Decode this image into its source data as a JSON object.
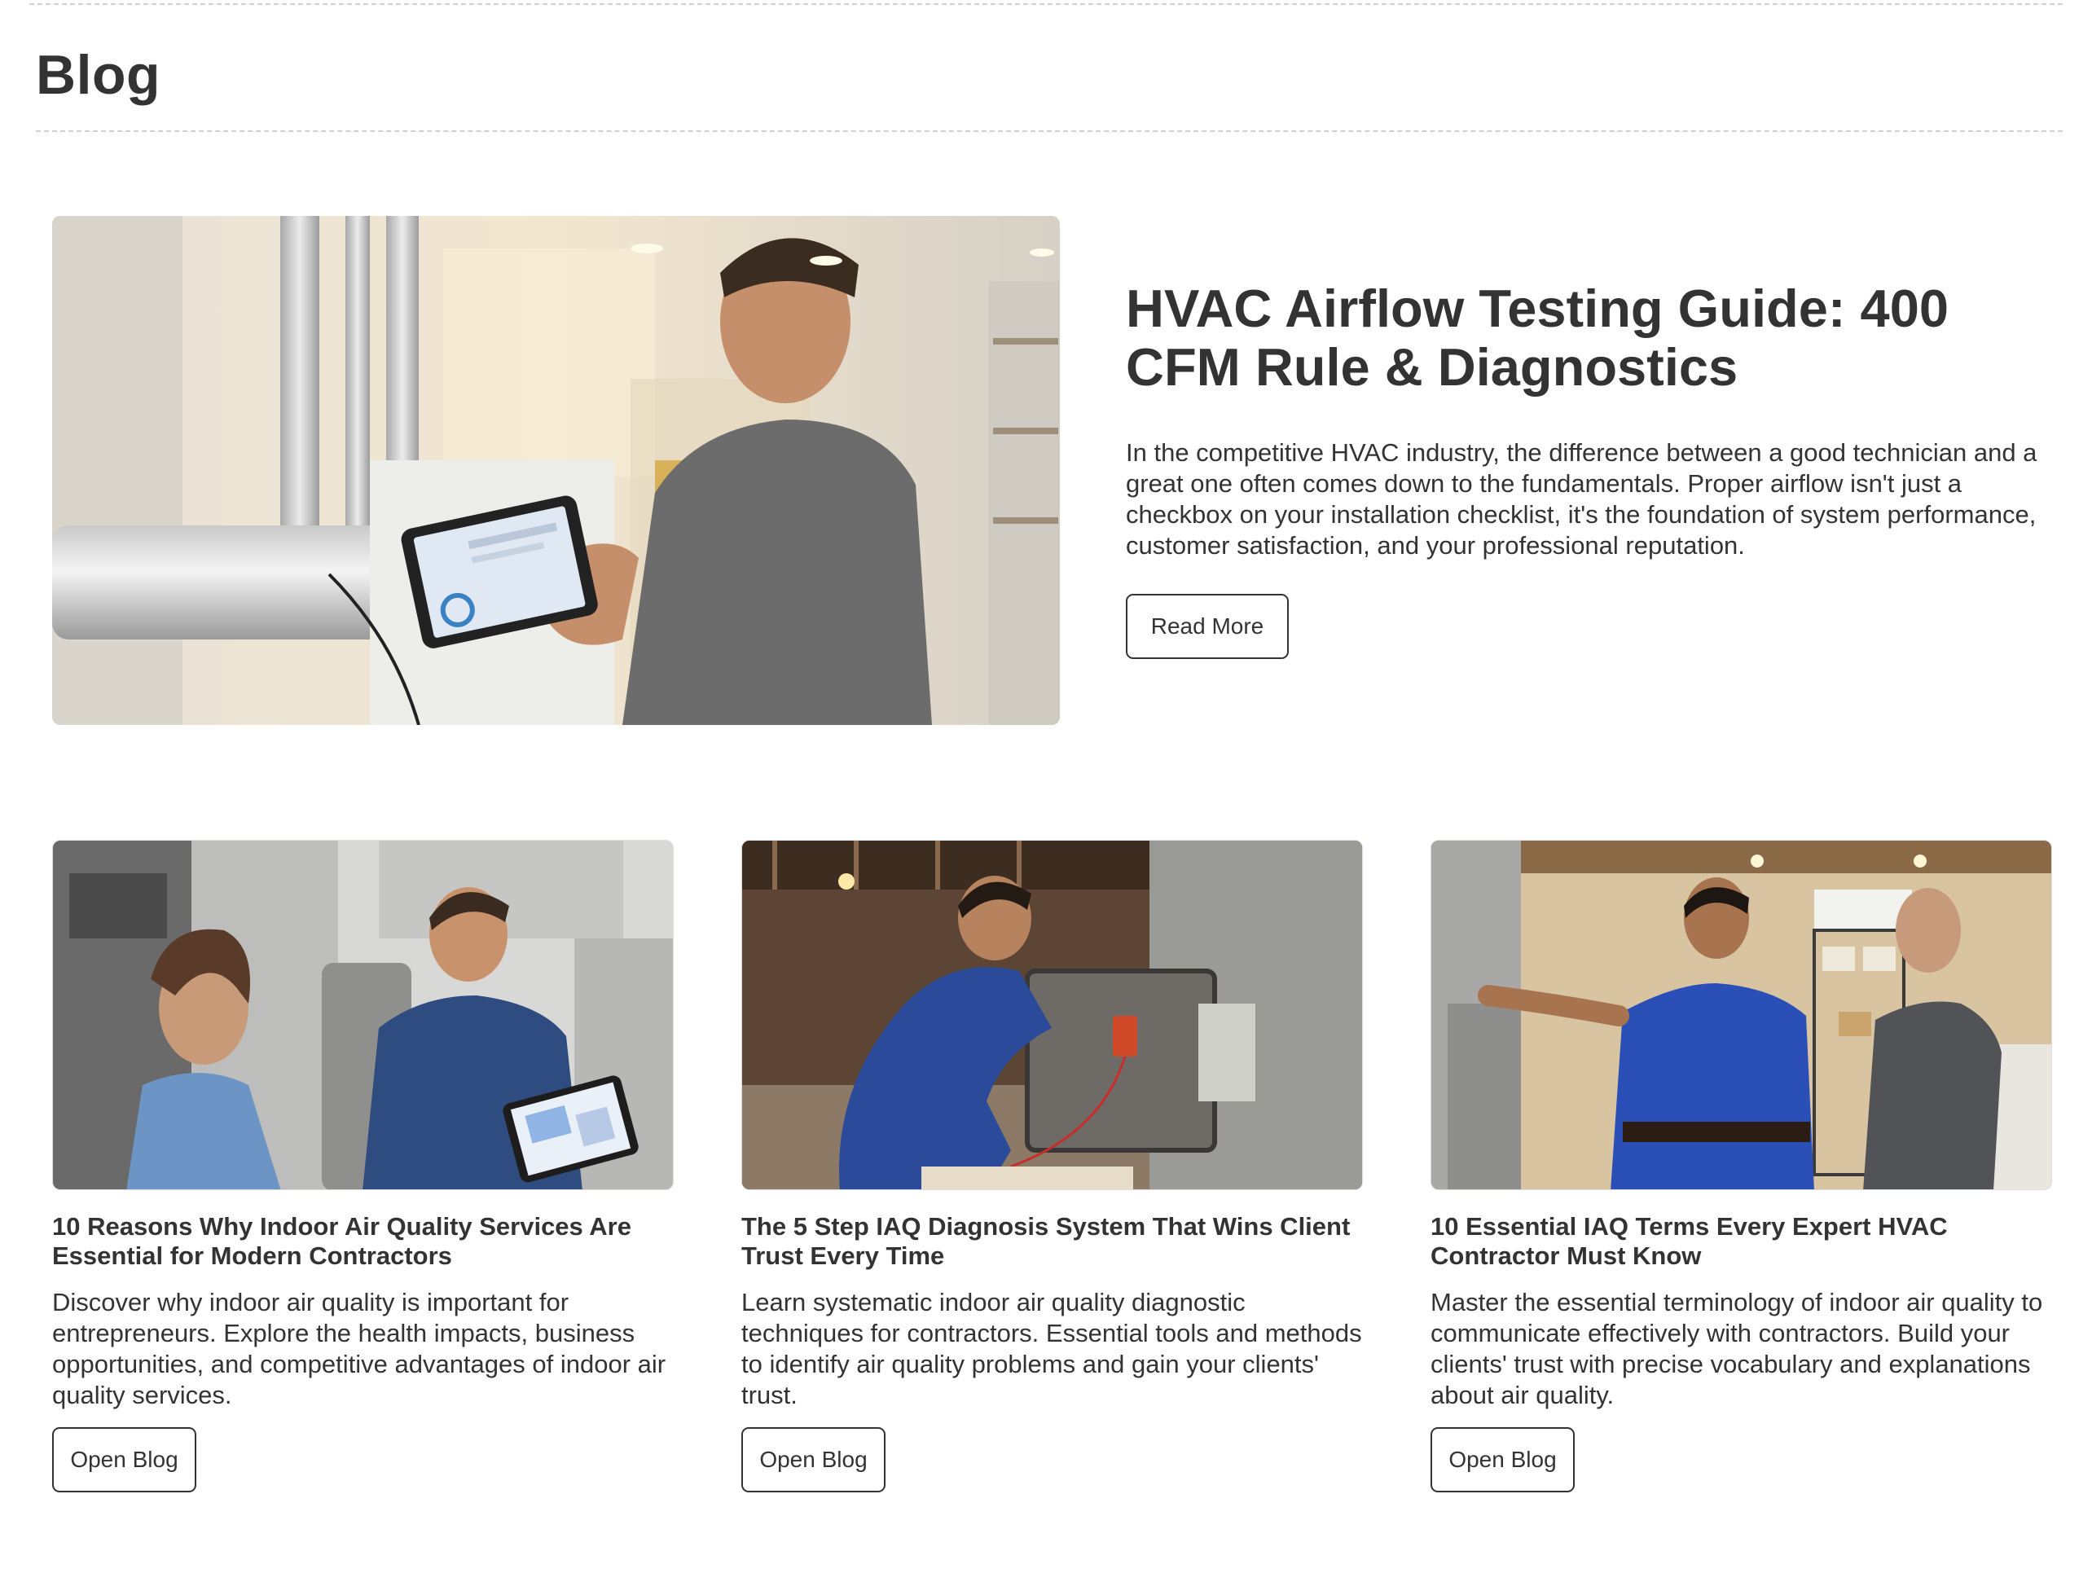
{
  "page": {
    "title": "Blog"
  },
  "featured": {
    "title": "HVAC Airflow Testing Guide: 400 CFM Rule & Diagnostics",
    "excerpt": "In the competitive HVAC industry, the difference between a good technician and a great one often comes down to the fundamentals. Proper airflow isn't just a checkbox on your installation checklist, it's the foundation of system performance, customer satisfaction, and your professional reputation.",
    "button_label": "Read More"
  },
  "cards": [
    {
      "title": "10 Reasons Why Indoor Air Quality Services Are Essential for Modern Contractors",
      "excerpt": "Discover why indoor air quality is important for entrepreneurs. Explore the health impacts, business opportunities, and competitive advantages of indoor air quality services.",
      "button_label": "Open Blog"
    },
    {
      "title": "The 5 Step IAQ Diagnosis System That Wins Client Trust Every Time",
      "excerpt": "Learn systematic indoor air quality diagnostic techniques for contractors. Essential tools and methods to identify air quality problems and gain your clients' trust.",
      "button_label": "Open Blog"
    },
    {
      "title": "10 Essential IAQ Terms Every Expert HVAC Contractor Must Know",
      "excerpt": "Master the essential terminology of indoor air quality to communicate effectively with contractors. Build your clients' trust with precise vocabulary and explanations about air quality.",
      "button_label": "Open Blog"
    }
  ]
}
